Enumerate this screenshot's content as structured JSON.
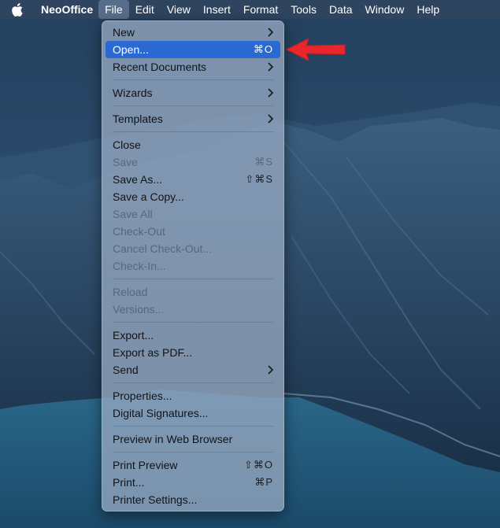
{
  "menubar": {
    "apple_icon": "apple-logo-icon",
    "items": [
      {
        "label": "NeoOffice"
      },
      {
        "label": "File"
      },
      {
        "label": "Edit"
      },
      {
        "label": "View"
      },
      {
        "label": "Insert"
      },
      {
        "label": "Format"
      },
      {
        "label": "Tools"
      },
      {
        "label": "Data"
      },
      {
        "label": "Window"
      },
      {
        "label": "Help"
      }
    ],
    "active_item": "File"
  },
  "file_menu": {
    "items": [
      {
        "label": "New",
        "submenu": true
      },
      {
        "label": "Open...",
        "shortcut": "⌘O",
        "highlighted": true
      },
      {
        "label": "Recent Documents",
        "submenu": true
      },
      {
        "label": "Wizards",
        "submenu": true
      },
      {
        "label": "Templates",
        "submenu": true
      },
      {
        "label": "Close"
      },
      {
        "label": "Save",
        "shortcut": "⌘S",
        "disabled": true
      },
      {
        "label": "Save As...",
        "shortcut": "⇧⌘S"
      },
      {
        "label": "Save a Copy..."
      },
      {
        "label": "Save All",
        "disabled": true
      },
      {
        "label": "Check-Out",
        "disabled": true
      },
      {
        "label": "Cancel Check-Out...",
        "disabled": true
      },
      {
        "label": "Check-In...",
        "disabled": true
      },
      {
        "label": "Reload",
        "disabled": true
      },
      {
        "label": "Versions...",
        "disabled": true
      },
      {
        "label": "Export..."
      },
      {
        "label": "Export as PDF..."
      },
      {
        "label": "Send",
        "submenu": true
      },
      {
        "label": "Properties..."
      },
      {
        "label": "Digital Signatures..."
      },
      {
        "label": "Preview in Web Browser"
      },
      {
        "label": "Print Preview",
        "shortcut": "⇧⌘O"
      },
      {
        "label": "Print...",
        "shortcut": "⌘P"
      },
      {
        "label": "Printer Settings..."
      }
    ]
  },
  "annotation": {
    "icon": "red-arrow-pointer-icon",
    "color": "#e8262b"
  },
  "colors": {
    "highlight": "#2a69d2",
    "menubar": "#304460",
    "wallpaper": "#1d3550"
  }
}
